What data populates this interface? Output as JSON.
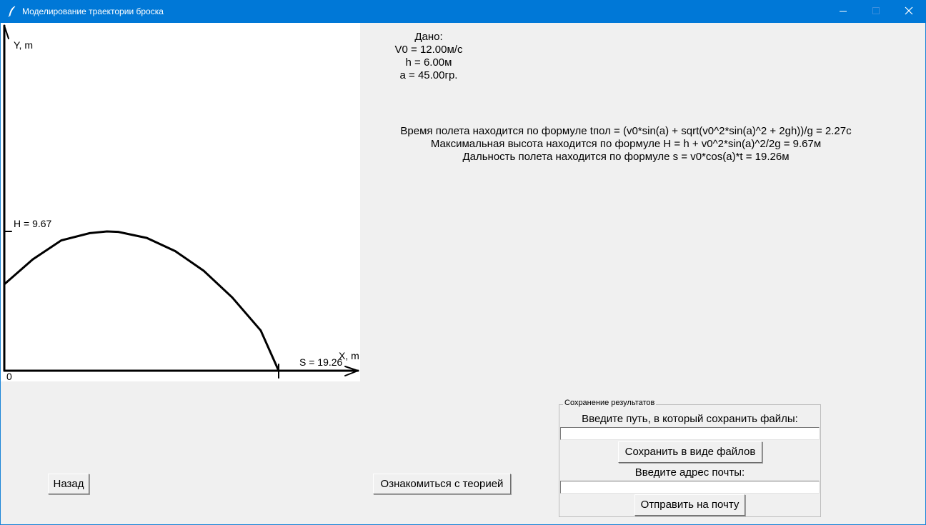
{
  "window": {
    "title": "Моделирование траектории броска"
  },
  "plot": {
    "y_axis_label": "Y, m",
    "x_axis_label": "X, m",
    "origin_label": "0",
    "max_height_label": "H = 9.67",
    "range_label": "S = 19.26"
  },
  "chart_data": {
    "type": "line",
    "xlabel": "X, m",
    "ylabel": "Y, m",
    "series": [
      {
        "x": [
          0,
          2,
          4,
          6,
          7.2,
          8,
          10,
          12,
          14,
          16,
          18,
          19.26
        ],
        "y": [
          6.0,
          7.73,
          9.05,
          9.55,
          9.67,
          9.64,
          9.22,
          8.3,
          6.94,
          5.09,
          2.79,
          0
        ]
      }
    ],
    "annotations": [
      "H = 9.67",
      "S = 19.26"
    ]
  },
  "given": {
    "heading": "Дано:",
    "v0": "V0 = 12.00м/с",
    "h": "h = 6.00м",
    "a": "a = 45.00гр."
  },
  "formulas": {
    "time": "Время полета находится по формуле tпол = (v0*sin(a) + sqrt(v0^2*sin(a)^2 + 2gh))/g = 2.27с",
    "height": "Максимальная высота находится по формуле H = h + v0^2*sin(a)^2/2g = 9.67м",
    "range": "Дальность полета находится по формуле s = v0*cos(a)*t = 19.26м"
  },
  "buttons": {
    "back": "Назад",
    "theory": "Ознакомиться с теорией",
    "save_files": "Сохранить в виде файлов",
    "send_mail": "Отправить на почту"
  },
  "save_group": {
    "legend": "Сохранение результатов",
    "path_label": "Введите путь, в который сохранить файлы:",
    "path_value": "",
    "email_label": "Введите адрес почты:",
    "email_value": ""
  },
  "icons": [
    "feather-icon",
    "minimize-icon",
    "maximize-icon",
    "close-icon"
  ]
}
